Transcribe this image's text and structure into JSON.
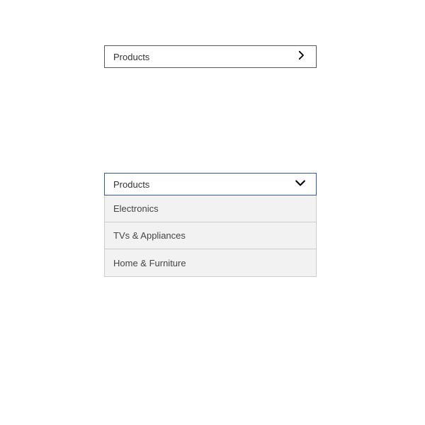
{
  "dropdown_closed": {
    "label": "Products"
  },
  "dropdown_open": {
    "label": "Products",
    "items": [
      {
        "label": "Electronics"
      },
      {
        "label": "TVs & Appliances"
      },
      {
        "label": "Home & Furniture"
      }
    ]
  }
}
